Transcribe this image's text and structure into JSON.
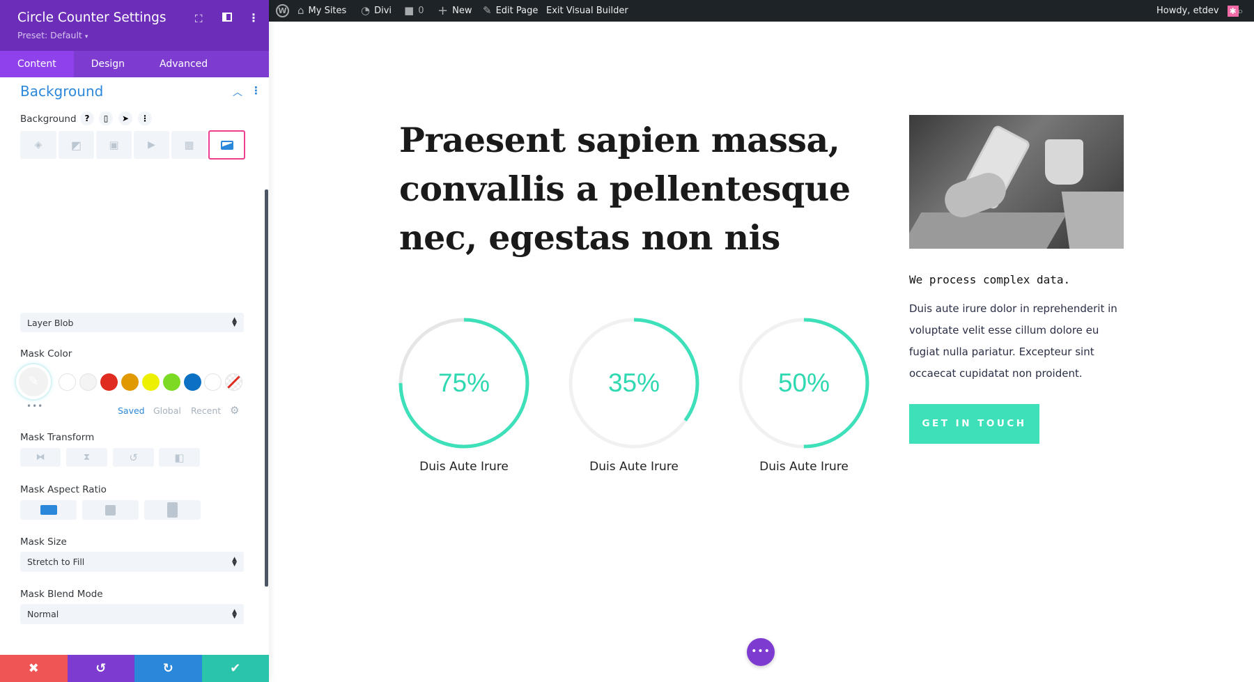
{
  "topbar": {
    "items": [
      {
        "label": "",
        "icon": "wordpress-icon"
      },
      {
        "label": "My Sites",
        "icon": "my-sites-icon"
      },
      {
        "label": "Divi",
        "icon": "dashboard-icon"
      },
      {
        "label": "0",
        "icon": "comment-icon"
      },
      {
        "label": "New",
        "icon": "plus-icon"
      },
      {
        "label": "Edit Page",
        "icon": "pencil-icon"
      },
      {
        "label": "Exit Visual Builder"
      }
    ],
    "greeting": "Howdy, etdev"
  },
  "panel": {
    "title": "Circle Counter Settings",
    "preset": "Preset: Default",
    "tabs": [
      "Content",
      "Design",
      "Advanced"
    ],
    "active_tab": "Content",
    "section_title": "Background",
    "background_label": "Background",
    "background_types": [
      "color",
      "gradient",
      "image",
      "video",
      "pattern",
      "mask"
    ],
    "active_background_type": "mask",
    "mask_style": "Layer Blob",
    "mask_color_label": "Mask Color",
    "swatches": [
      "#ffffff",
      "#f4f4f4",
      "#e02b20",
      "#e09900",
      "#edf000",
      "#7cda24",
      "#0c71c3",
      "#ffffff",
      "transparent"
    ],
    "palette_tabs": [
      "Saved",
      "Global",
      "Recent"
    ],
    "active_palette_tab": "Saved",
    "mask_transform_label": "Mask Transform",
    "mask_aspect_ratio_label": "Mask Aspect Ratio",
    "mask_size_label": "Mask Size",
    "mask_size": "Stretch to Fill",
    "mask_blend_mode_label": "Mask Blend Mode",
    "mask_blend_mode": "Normal",
    "colors": {
      "header": "#6c2eb9",
      "tabs": "#7e3bd0",
      "accent": "#2b87da",
      "cancel": "#ef5555",
      "undo": "#7e3bd0",
      "redo": "#2b87da",
      "save": "#29c4a9"
    }
  },
  "main": {
    "heading": [
      "Praesent sapien massa,",
      "convallis a pellentesque",
      "nec, egestas non nis"
    ],
    "counters": [
      {
        "value": 75,
        "label": "75%",
        "title": "Duis Aute Irure"
      },
      {
        "value": 35,
        "label": "35%",
        "title": "Duis Aute Irure"
      },
      {
        "value": 50,
        "label": "50%",
        "title": "Duis Aute Irure"
      }
    ],
    "subheading": "We process complex data.",
    "paragraph": [
      "Duis aute irure dolor in reprehenderit in",
      "voluptate velit esse cillum dolore eu",
      "fugiat nulla pariatur. Excepteur sint",
      "occaecat cupidatat non proident."
    ],
    "cta": "GET IN TOUCH",
    "accent": "#3ee0b9"
  }
}
